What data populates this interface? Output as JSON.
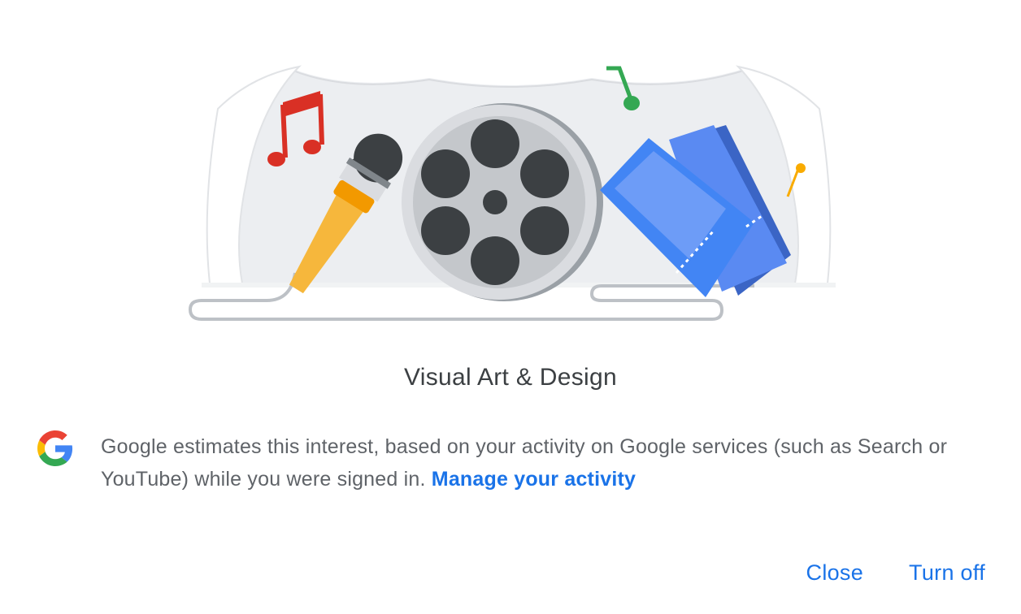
{
  "dialog": {
    "title": "Visual Art & Design",
    "description": "Google estimates this interest, based on your activity on Google services (such as Search or YouTube) while you were signed in.",
    "manage_link": "Manage your activity",
    "close_label": "Close",
    "turn_off_label": "Turn off"
  },
  "icons": {
    "logo": "google-g-icon",
    "illustration": "stage-microphone-film-reel-tickets-illustration"
  },
  "colors": {
    "accent": "#1a73e8",
    "title": "#3c4043",
    "body": "#5f6368"
  }
}
